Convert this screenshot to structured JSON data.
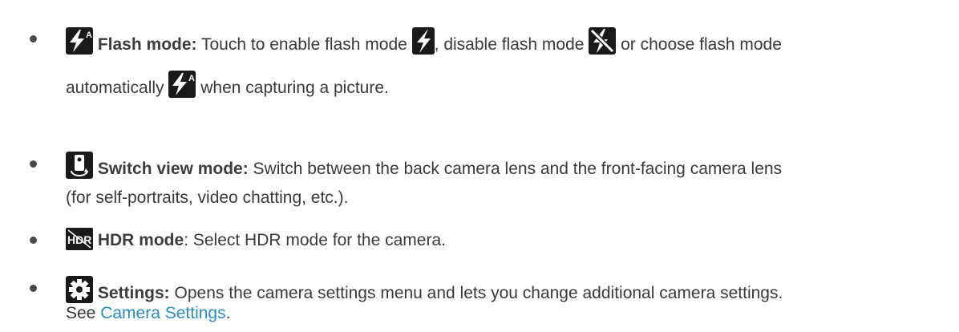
{
  "items": [
    {
      "icon": "flash-auto-icon",
      "term": "Flash mode:",
      "line1_a": " Touch to enable flash mode ",
      "line1_b": ", disable flash mode ",
      "line1_c": " or choose flash mode",
      "line2_a": "automatically ",
      "line2_b": "  when capturing a picture."
    },
    {
      "icon": "switch-camera-icon",
      "term": "Switch view mode:",
      "line1": " Switch between the back camera lens and the front-facing camera lens",
      "line2": "(for self-portraits, video chatting, etc.)."
    },
    {
      "icon": "hdr-icon",
      "term": "HDR mode",
      "line1": ": Select HDR mode for the camera."
    },
    {
      "icon": "gear-icon",
      "term": "Settings:",
      "line1": " Opens the camera settings menu and lets you change additional camera settings.",
      "line2_a": "See ",
      "line2_link": "Camera Settings",
      "line2_b": "."
    }
  ],
  "colors": {
    "text": "#3a3a3a",
    "link": "#2a8dbd",
    "icon_bg": "#1a1a1a",
    "icon_fg": "#ffffff"
  }
}
